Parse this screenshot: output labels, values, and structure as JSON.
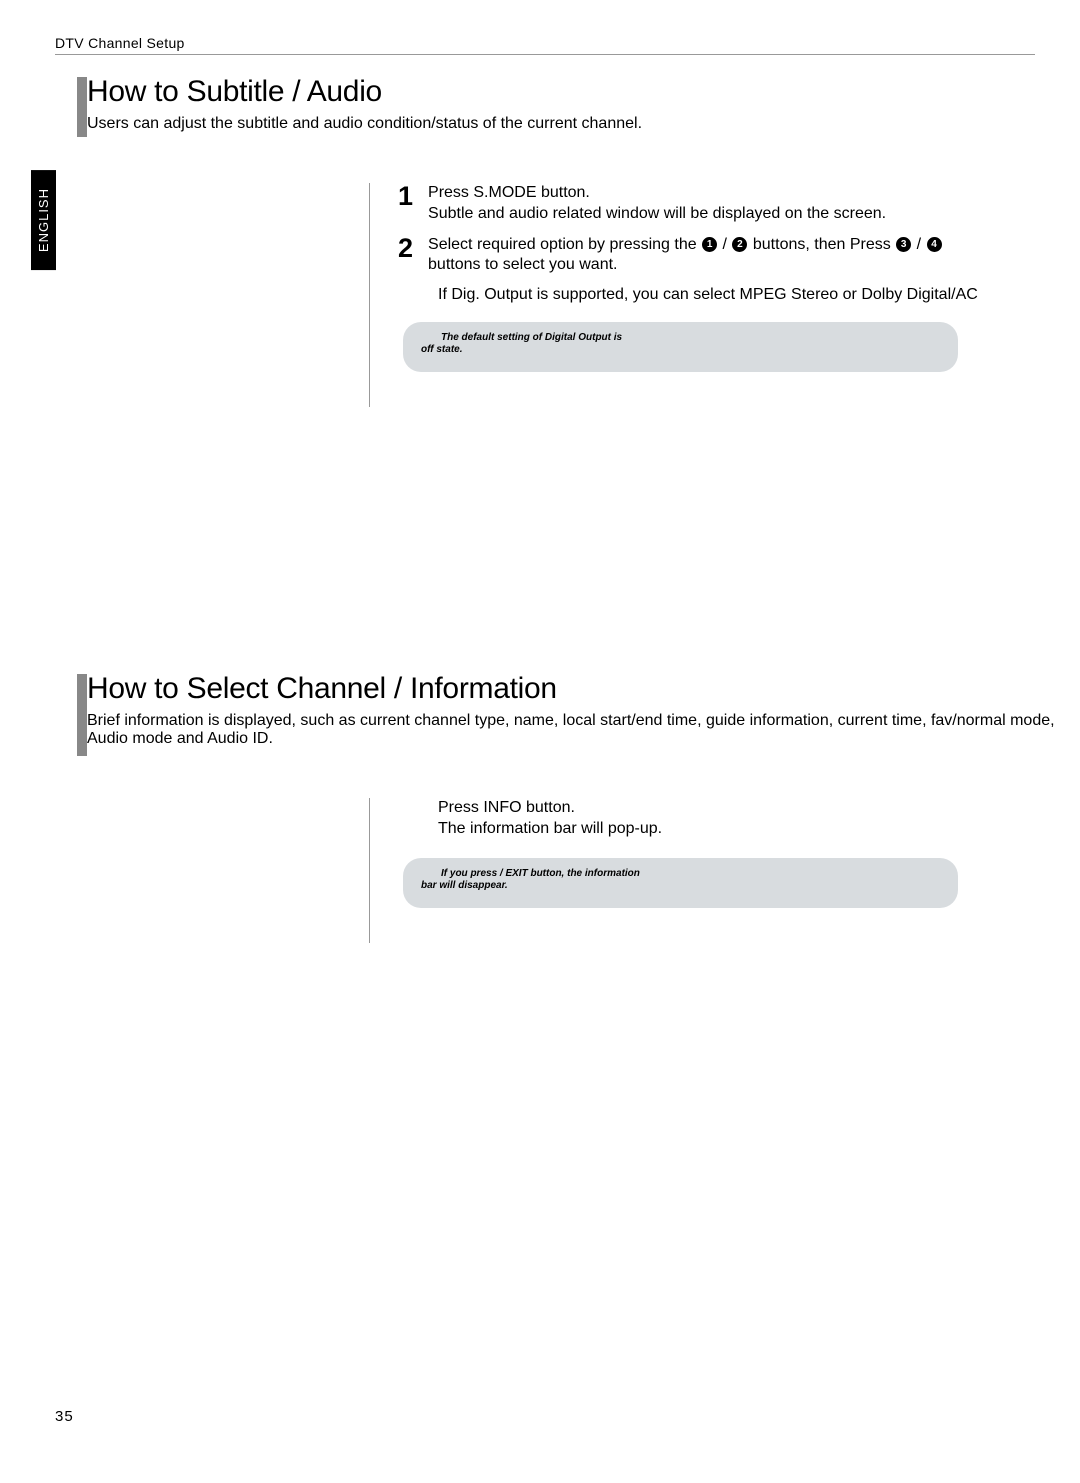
{
  "header": {
    "breadcrumb": "DTV Channel Setup",
    "language": "ENGLISH"
  },
  "section1": {
    "title": "How to Subtitle / Audio",
    "description": "Users can adjust the subtitle and audio condition/status of the current channel.",
    "steps": [
      {
        "num": "1",
        "line1_a": "Press ",
        "line1_b": "S.MODE",
        "line1_c": " button.",
        "line2": "Subtle and audio related window will be displayed on the screen."
      },
      {
        "num": "2",
        "line1_a": "Select required option by pressing the ",
        "line1_b": " / ",
        "line1_c": " buttons, then Press ",
        "line1_d": " / ",
        "line2": "buttons to select you want."
      }
    ],
    "note": "If Dig. Output is supported, you can select MPEG Stereo or Dolby Digital/AC",
    "boxLine1": "The default setting of Digital Output is",
    "boxLine2": "off state."
  },
  "section2": {
    "title": "How to Select Channel / Information",
    "description": "Brief information is displayed, such as current channel type, name, local start/end time, guide information, current time, fav/normal mode, Audio mode and Audio ID.",
    "step_line1_a": "Press ",
    "step_line1_b": "INFO",
    "step_line1_c": " button.",
    "step_line2": "The information bar will pop-up.",
    "boxLine1": "If you press     / EXIT button, the information",
    "boxLine2": "bar will disappear."
  },
  "pageNumber": "35"
}
